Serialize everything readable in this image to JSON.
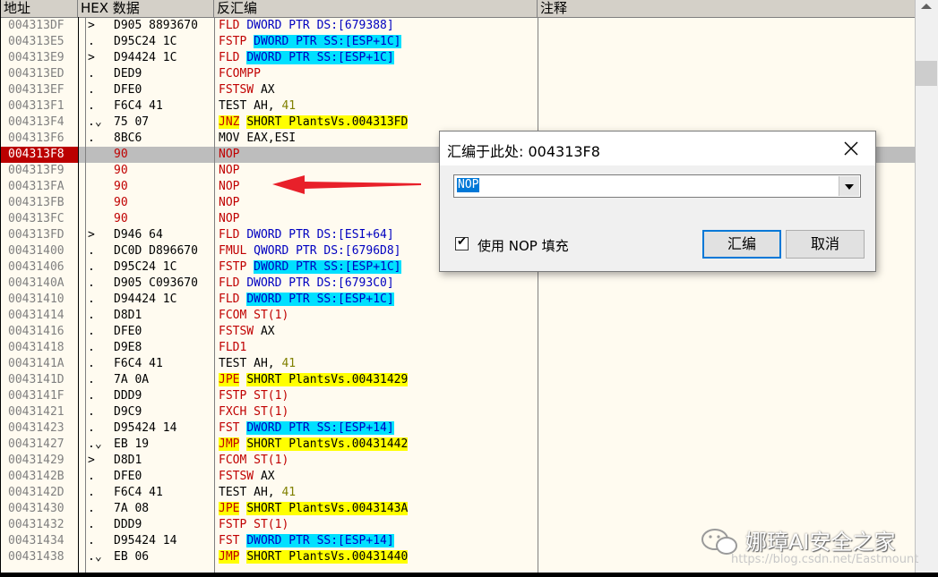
{
  "headers": {
    "address": "地址",
    "hex": "HEX 数据",
    "disasm": "反汇编",
    "comment": "注释"
  },
  "rows": [
    {
      "addr": "004313DF",
      "mark": ">",
      "hex": "D905 8893670",
      "m": "FLD",
      "mc": "red",
      "ops": [
        {
          "t": "DWORD PTR DS:[679388]",
          "c": "blue"
        }
      ]
    },
    {
      "addr": "004313E5",
      "mark": ".",
      "hex": "D95C24 1C",
      "m": "FSTP",
      "mc": "red",
      "ops": [
        {
          "t": "DWORD PTR SS:[ESP+1C]",
          "c": "cyan"
        }
      ]
    },
    {
      "addr": "004313E9",
      "mark": ">",
      "hex": "D94424 1C",
      "m": "FLD",
      "mc": "red",
      "ops": [
        {
          "t": "DWORD PTR SS:[ESP+1C]",
          "c": "cyan"
        }
      ]
    },
    {
      "addr": "004313ED",
      "mark": ".",
      "hex": "DED9",
      "m": "FCOMPP",
      "mc": "red",
      "ops": []
    },
    {
      "addr": "004313EF",
      "mark": ".",
      "hex": "DFE0",
      "m": "FSTSW",
      "mc": "red",
      "ops": [
        {
          "t": "AX",
          "c": "blk"
        }
      ]
    },
    {
      "addr": "004313F1",
      "mark": ".",
      "hex": "F6C4 41",
      "m": "TEST",
      "mc": "blk",
      "ops": [
        {
          "t": "AH,",
          "c": "blk"
        },
        {
          "t": "41",
          "c": "num"
        }
      ]
    },
    {
      "addr": "004313F4",
      "mark": ".⌄",
      "hex": "75 07",
      "m": "JNZ",
      "mc": "yel",
      "ops": [
        {
          "t": "SHORT PlantsVs.004313FD",
          "c": "yel"
        }
      ]
    },
    {
      "addr": "004313F6",
      "mark": ".",
      "hex": "8BC6",
      "m": "MOV",
      "mc": "blk",
      "ops": [
        {
          "t": "EAX,ESI",
          "c": "blk"
        }
      ]
    },
    {
      "addr": "004313F8",
      "mark": "",
      "hex": "90",
      "m": "NOP",
      "mc": "red",
      "ops": [],
      "sel": true,
      "nop": true
    },
    {
      "addr": "004313F9",
      "mark": "",
      "hex": "90",
      "m": "NOP",
      "mc": "red",
      "ops": [],
      "nop": true
    },
    {
      "addr": "004313FA",
      "mark": "",
      "hex": "90",
      "m": "NOP",
      "mc": "red",
      "ops": [],
      "nop": true
    },
    {
      "addr": "004313FB",
      "mark": "",
      "hex": "90",
      "m": "NOP",
      "mc": "red",
      "ops": [],
      "nop": true
    },
    {
      "addr": "004313FC",
      "mark": "",
      "hex": "90",
      "m": "NOP",
      "mc": "red",
      "ops": [],
      "nop": true
    },
    {
      "addr": "004313FD",
      "mark": ">",
      "hex": "D946 64",
      "m": "FLD",
      "mc": "red",
      "ops": [
        {
          "t": "DWORD PTR DS:[ESI+64]",
          "c": "blue"
        }
      ]
    },
    {
      "addr": "00431400",
      "mark": ".",
      "hex": "DC0D D896670",
      "m": "FMUL",
      "mc": "red",
      "ops": [
        {
          "t": "QWORD PTR DS:[6796D8]",
          "c": "blue"
        }
      ]
    },
    {
      "addr": "00431406",
      "mark": ".",
      "hex": "D95C24 1C",
      "m": "FSTP",
      "mc": "red",
      "ops": [
        {
          "t": "DWORD PTR SS:[ESP+1C]",
          "c": "cyan"
        }
      ]
    },
    {
      "addr": "0043140A",
      "mark": ".",
      "hex": "D905 C093670",
      "m": "FLD",
      "mc": "red",
      "ops": [
        {
          "t": "DWORD PTR DS:[6793C0]",
          "c": "blue"
        }
      ]
    },
    {
      "addr": "00431410",
      "mark": ".",
      "hex": "D94424 1C",
      "m": "FLD",
      "mc": "red",
      "ops": [
        {
          "t": "DWORD PTR SS:[ESP+1C]",
          "c": "cyan"
        }
      ]
    },
    {
      "addr": "00431414",
      "mark": ".",
      "hex": "D8D1",
      "m": "FCOM",
      "mc": "red",
      "ops": [
        {
          "t": "ST(1)",
          "c": "red"
        }
      ]
    },
    {
      "addr": "00431416",
      "mark": ".",
      "hex": "DFE0",
      "m": "FSTSW",
      "mc": "red",
      "ops": [
        {
          "t": "AX",
          "c": "blk"
        }
      ]
    },
    {
      "addr": "00431418",
      "mark": ".",
      "hex": "D9E8",
      "m": "FLD1",
      "mc": "red",
      "ops": []
    },
    {
      "addr": "0043141A",
      "mark": ".",
      "hex": "F6C4 41",
      "m": "TEST",
      "mc": "blk",
      "ops": [
        {
          "t": "AH,",
          "c": "blk"
        },
        {
          "t": "41",
          "c": "num"
        }
      ]
    },
    {
      "addr": "0043141D",
      "mark": ".",
      "hex": "7A 0A",
      "m": "JPE",
      "mc": "yel",
      "ops": [
        {
          "t": "SHORT PlantsVs.00431429",
          "c": "yel"
        }
      ]
    },
    {
      "addr": "0043141F",
      "mark": ".",
      "hex": "DDD9",
      "m": "FSTP",
      "mc": "red",
      "ops": [
        {
          "t": "ST(1)",
          "c": "red"
        }
      ]
    },
    {
      "addr": "00431421",
      "mark": ".",
      "hex": "D9C9",
      "m": "FXCH",
      "mc": "red",
      "ops": [
        {
          "t": "ST(1)",
          "c": "red"
        }
      ]
    },
    {
      "addr": "00431423",
      "mark": ".",
      "hex": "D95424 14",
      "m": "FST",
      "mc": "red",
      "ops": [
        {
          "t": "DWORD PTR SS:[ESP+14]",
          "c": "cyan"
        }
      ]
    },
    {
      "addr": "00431427",
      "mark": ".⌄",
      "hex": "EB 19",
      "m": "JMP",
      "mc": "yel",
      "ops": [
        {
          "t": "SHORT PlantsVs.00431442",
          "c": "yel"
        }
      ]
    },
    {
      "addr": "00431429",
      "mark": ">",
      "hex": "D8D1",
      "m": "FCOM",
      "mc": "red",
      "ops": [
        {
          "t": "ST(1)",
          "c": "red"
        }
      ]
    },
    {
      "addr": "0043142B",
      "mark": ".",
      "hex": "DFE0",
      "m": "FSTSW",
      "mc": "red",
      "ops": [
        {
          "t": "AX",
          "c": "blk"
        }
      ]
    },
    {
      "addr": "0043142D",
      "mark": ".",
      "hex": "F6C4 41",
      "m": "TEST",
      "mc": "blk",
      "ops": [
        {
          "t": "AH,",
          "c": "blk"
        },
        {
          "t": "41",
          "c": "num"
        }
      ]
    },
    {
      "addr": "00431430",
      "mark": ".",
      "hex": "7A 08",
      "m": "JPE",
      "mc": "yel",
      "ops": [
        {
          "t": "SHORT PlantsVs.0043143A",
          "c": "yel"
        }
      ]
    },
    {
      "addr": "00431432",
      "mark": ".",
      "hex": "DDD9",
      "m": "FSTP",
      "mc": "red",
      "ops": [
        {
          "t": "ST(1)",
          "c": "red"
        }
      ]
    },
    {
      "addr": "00431434",
      "mark": ".",
      "hex": "D95424 14",
      "m": "FST",
      "mc": "red",
      "ops": [
        {
          "t": "DWORD PTR SS:[ESP+14]",
          "c": "cyan"
        }
      ]
    },
    {
      "addr": "00431438",
      "mark": ".⌄",
      "hex": "EB 06",
      "m": "JMP",
      "mc": "yel",
      "ops": [
        {
          "t": "SHORT PlantsVs.00431440",
          "c": "yel"
        }
      ]
    }
  ],
  "dialog": {
    "title": "汇编于此处: 004313F8",
    "input_value": "NOP",
    "checkbox_label": "使用 NOP 填充",
    "checkbox_checked": "✔",
    "assemble_label": "汇编",
    "cancel_label": "取消"
  },
  "watermark": {
    "name": "娜璋AI安全之家",
    "url": "https://blog.csdn.net/Eastmount"
  },
  "colors": {
    "selected_address_bg": "#bb0000",
    "cyan_operand": "#00e0ff",
    "yellow_jump": "#ffff00",
    "annotation_arrow": "#e8202a"
  }
}
